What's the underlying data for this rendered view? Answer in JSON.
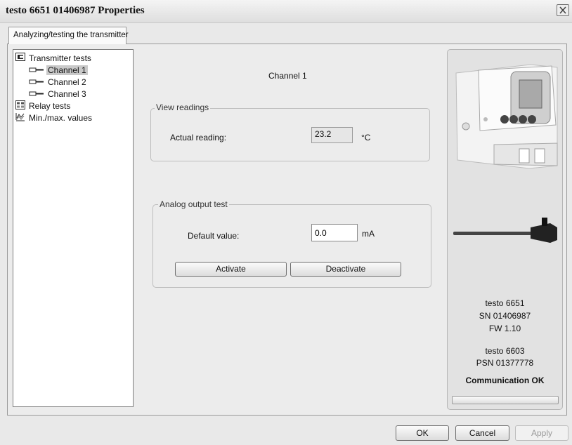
{
  "window": {
    "title": "testo 6651  01406987 Properties"
  },
  "tabs": [
    {
      "label": "Analyzing/testing the transmitter",
      "active": true
    }
  ],
  "tree": {
    "items": [
      {
        "label": "Transmitter tests",
        "icon": "transmitter-icon",
        "level": 0
      },
      {
        "label": "Channel 1",
        "icon": "channel-icon",
        "level": 1,
        "selected": true
      },
      {
        "label": "Channel 2",
        "icon": "channel-icon",
        "level": 1
      },
      {
        "label": "Channel 3",
        "icon": "channel-icon",
        "level": 1
      },
      {
        "label": "Relay tests",
        "icon": "relay-icon",
        "level": 0
      },
      {
        "label": "Min./max. values",
        "icon": "minmax-icon",
        "level": 0
      }
    ]
  },
  "main": {
    "heading": "Channel 1",
    "view_readings": {
      "legend": "View readings",
      "label": "Actual reading:",
      "value": "23.2",
      "unit": "°C"
    },
    "analog_output": {
      "legend": "Analog output test",
      "label": "Default value:",
      "value": "0.0",
      "unit": "mA",
      "activate_label": "Activate",
      "deactivate_label": "Deactivate"
    }
  },
  "device": {
    "model": "testo 6651",
    "serial": "SN 01406987",
    "firmware": "FW  1.10",
    "probe_model": "testo 6603",
    "probe_serial": "PSN 01377778",
    "status": "Communication OK"
  },
  "footer": {
    "ok_label": "OK",
    "cancel_label": "Cancel",
    "apply_label": "Apply"
  }
}
